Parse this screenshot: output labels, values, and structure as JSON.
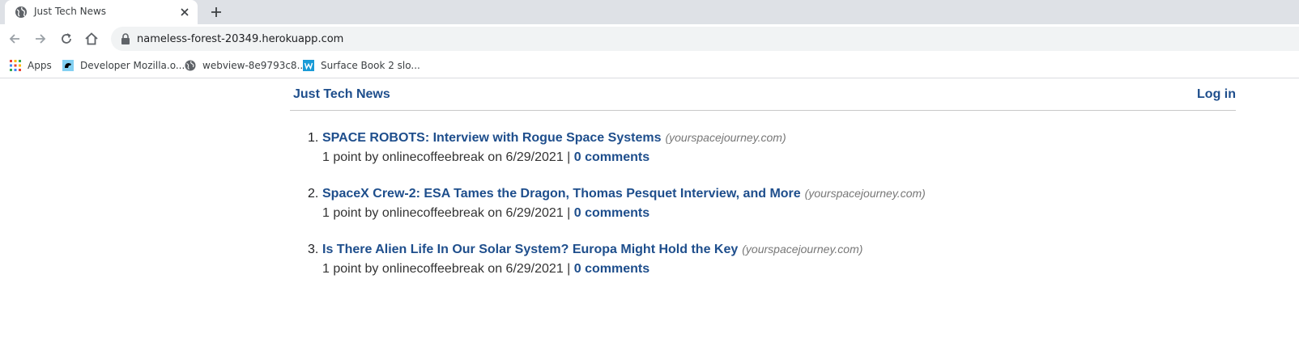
{
  "browser": {
    "tab": {
      "title": "Just Tech News"
    },
    "address_bar": {
      "url": "nameless-forest-20349.herokuapp.com"
    },
    "bookmarks": [
      {
        "label": "Apps",
        "icon": "apps-grid-icon"
      },
      {
        "label": "Developer Mozilla.o...",
        "icon": "mdn-dinosaur-icon"
      },
      {
        "label": "webview-8e9793c8...",
        "icon": "globe-icon"
      },
      {
        "label": "Surface Book 2 slo...",
        "icon": "w-logo-icon"
      }
    ]
  },
  "header": {
    "site_title": "Just Tech News",
    "login_label": "Log in"
  },
  "posts": [
    {
      "number": "1.",
      "title": "SPACE ROBOTS: Interview with Rogue Space Systems",
      "domain": "(yourspacejourney.com)",
      "meta": "1 point by onlinecoffeebreak on 6/29/2021 |",
      "comments": "0 comments"
    },
    {
      "number": "2.",
      "title": "SpaceX Crew-2: ESA Tames the Dragon, Thomas Pesquet Interview, and More",
      "domain": "(yourspacejourney.com)",
      "meta": "1 point by onlinecoffeebreak on 6/29/2021 |",
      "comments": "0 comments"
    },
    {
      "number": "3.",
      "title": "Is There Alien Life In Our Solar System? Europa Might Hold the Key",
      "domain": "(yourspacejourney.com)",
      "meta": "1 point by onlinecoffeebreak on 6/29/2021 |",
      "comments": "0 comments"
    }
  ],
  "colors": {
    "link": "#1e4e8c",
    "domain": "#777777",
    "tabstrip": "#dee1e6",
    "omnibox": "#f1f3f4"
  }
}
